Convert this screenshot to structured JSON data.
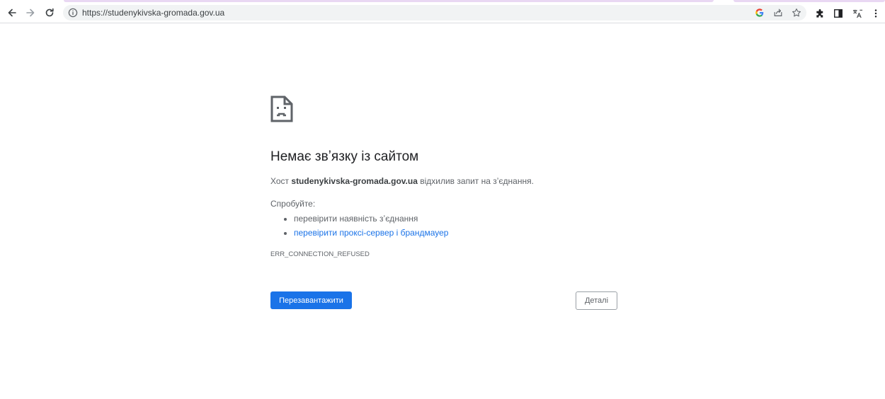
{
  "browser": {
    "url": "https://studenykivska-gromada.gov.ua",
    "icons": [
      "back-icon",
      "forward-icon",
      "reload-icon",
      "info-icon",
      "google-icon",
      "share-icon",
      "bookmark-star-icon",
      "extensions-icon",
      "side-panel-icon",
      "translate-icon",
      "menu-icon"
    ]
  },
  "error": {
    "icon": "sad-page-icon",
    "title": "Немає звʼязку із сайтом",
    "message_prefix": "Хост",
    "host": "studenykivska-gromada.gov.ua",
    "message_suffix": "відхилив запит на зʼєднання.",
    "try_label": "Спробуйте:",
    "suggestions": [
      "перевірити наявність зʼєднання",
      "перевірити проксі-сервер і брандмауер"
    ],
    "code": "ERR_CONNECTION_REFUSED",
    "reload_label": "Перезавантажити",
    "details_label": "Деталі"
  },
  "colors": {
    "primary_button": "#1a73e8",
    "link": "#1a73e8",
    "text": "#202124",
    "secondary_text": "#5f6368"
  }
}
